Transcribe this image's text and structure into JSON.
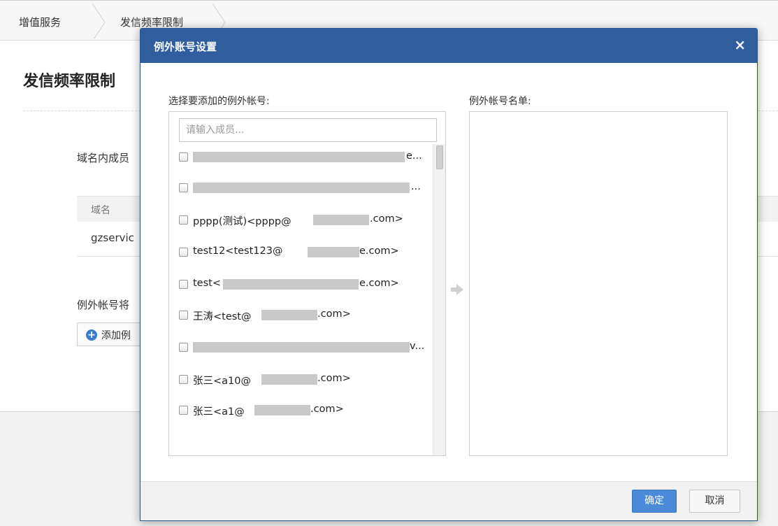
{
  "breadcrumb": {
    "items": [
      "增值服务",
      "发信频率限制"
    ]
  },
  "background": {
    "title": "发信频率限制",
    "member_label": "域名内成员",
    "table_header_domain": "域名",
    "table_cell_domain": "gzservic",
    "exception_label": "例外帐号将",
    "add_button_label": "添加例"
  },
  "modal": {
    "title": "例外账号设置",
    "close_glyph": "×",
    "left_label": "选择要添加的例外帐号:",
    "right_label": "例外帐号名单:",
    "search_placeholder": "请输入成员...",
    "members": [
      {
        "text": "",
        "suffix": "e..."
      },
      {
        "text": "",
        "suffix": "..."
      },
      {
        "text": "pppp(测试)<pppp@",
        "suffix": ".com>"
      },
      {
        "text": "test12<test123@",
        "suffix": "e.com>"
      },
      {
        "text": "test<",
        "suffix": "e.com>"
      },
      {
        "text": "王涛<test@",
        "suffix": ".com>"
      },
      {
        "text": "",
        "suffix": "v..."
      },
      {
        "text": "张三<a10@",
        "suffix": ".com>"
      },
      {
        "text": "张三<a1@",
        "suffix": ".com>"
      }
    ],
    "ok_label": "确定",
    "cancel_label": "取消"
  },
  "colors": {
    "header": "#2f5d9e",
    "primary_button": "#4a8ad8",
    "redaction": "#c9c9c9"
  }
}
